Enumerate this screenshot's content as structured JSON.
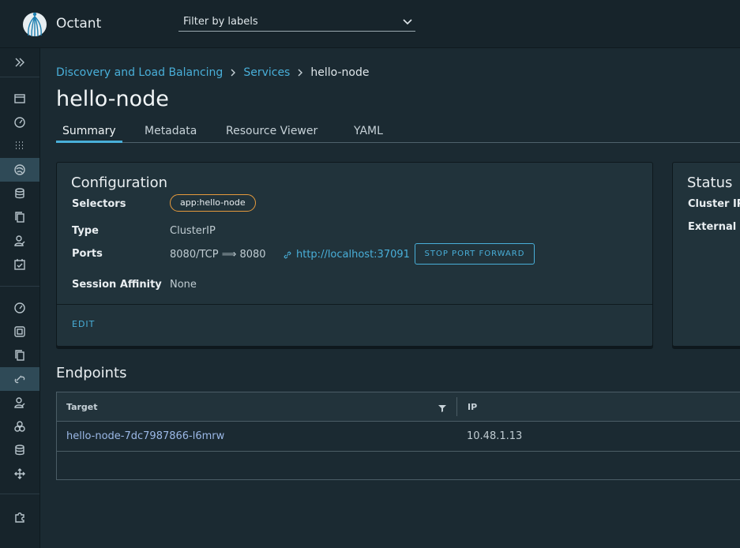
{
  "app": {
    "title": "Octant"
  },
  "filter": {
    "placeholder": "Filter by labels"
  },
  "breadcrumb": {
    "items": [
      {
        "label": "Discovery and Load Balancing"
      },
      {
        "label": "Services"
      }
    ],
    "current": "hello-node"
  },
  "page": {
    "title": "hello-node"
  },
  "tabs": [
    {
      "label": "Summary",
      "active": true
    },
    {
      "label": "Metadata"
    },
    {
      "label": "Resource Viewer"
    },
    {
      "label": "YAML"
    }
  ],
  "configuration": {
    "title": "Configuration",
    "selectors_label": "Selectors",
    "selector_chip": "app:hello-node",
    "type_label": "Type",
    "type_value": "ClusterIP",
    "ports_label": "Ports",
    "ports_value": "8080/TCP ⟹ 8080",
    "port_forward_link": "http://localhost:37091",
    "stop_button": "STOP PORT FORWARD",
    "session_label": "Session Affinity",
    "session_value": "None",
    "edit_label": "EDIT"
  },
  "status": {
    "title": "Status",
    "cluster_ip_label": "Cluster IP",
    "external_ip_label": "External IP"
  },
  "endpoints": {
    "title": "Endpoints",
    "columns": [
      "Target",
      "IP"
    ],
    "rows": [
      {
        "target": "hello-node-7dc7987866-l6mrw",
        "ip": "10.48.1.13"
      }
    ]
  },
  "colors": {
    "accent": "#49afd9",
    "chip_border": "#e69a3c",
    "background": "#1b2a32"
  }
}
